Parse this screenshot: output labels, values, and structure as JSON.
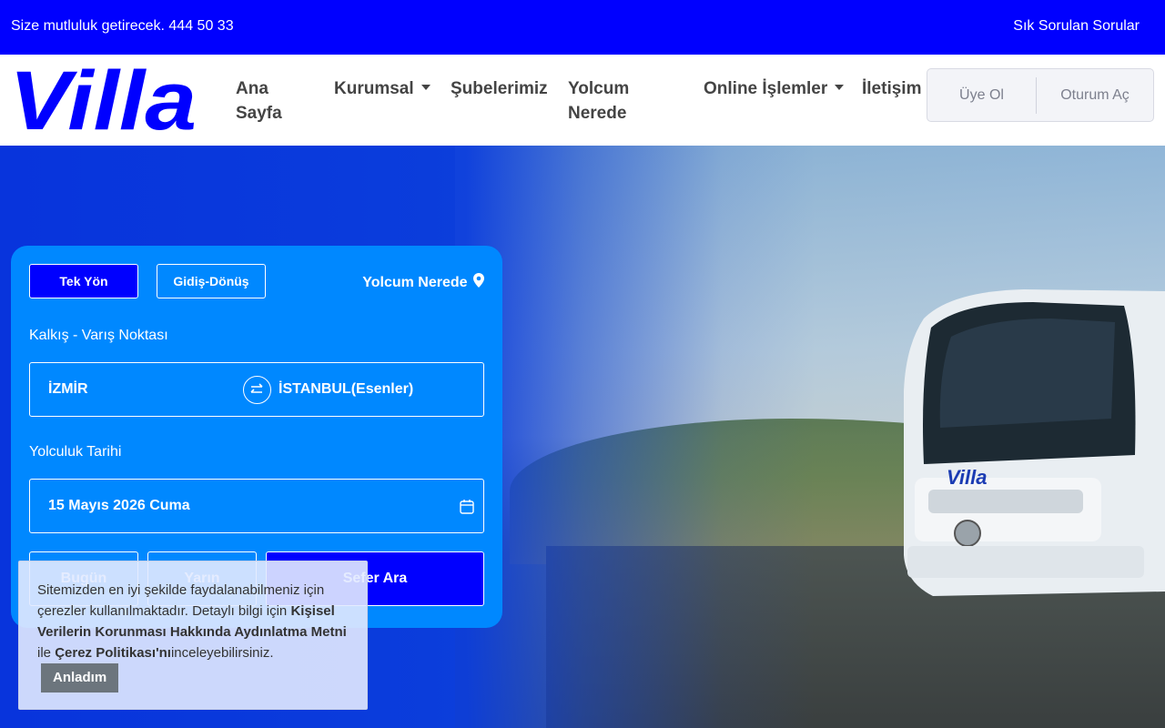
{
  "topbar": {
    "slogan": "Size mutluluk getirecek. 444 50 33",
    "faq": "Sık Sorulan Sorular"
  },
  "brand": {
    "logo_text": "Villa",
    "primary_color": "#0000ff",
    "panel_color": "#0088ff"
  },
  "nav": {
    "items": [
      {
        "label": "Ana Sayfa"
      },
      {
        "label": "Kurumsal"
      },
      {
        "label": "Şubelerimiz"
      },
      {
        "label": "Yolcum Nerede"
      },
      {
        "label": "Online İşlemler"
      },
      {
        "label": "İletişim"
      }
    ],
    "signup": "Üye Ol",
    "login": "Oturum Aç"
  },
  "search": {
    "tab_oneway": "Tek Yön",
    "tab_roundtrip": "Gidiş-Dönüş",
    "where_link": "Yolcum Nerede",
    "route_label": "Kalkış - Varış Noktası",
    "origin": "İZMİR",
    "destination": "İSTANBUL(Esenler)",
    "date_label": "Yolculuk Tarihi",
    "date_value": "15 Mayıs 2026 Cuma",
    "today": "Bugün",
    "tomorrow": "Yarın",
    "submit": "Sefer Ara"
  },
  "cookie": {
    "text1": "Sitemizden en iyi şekilde faydalanabilmeniz için çerezler kullanılmaktadır. Detaylı bilgi için ",
    "link1": "Kişisel Verilerin Korunması Hakkında Aydınlatma Metni",
    "text2": " ile ",
    "link2": "Çerez Politikası'nı",
    "text3": "inceleyebilirsiniz.",
    "accept": "Anladım"
  },
  "bus": {
    "logo_text": "Villa"
  }
}
